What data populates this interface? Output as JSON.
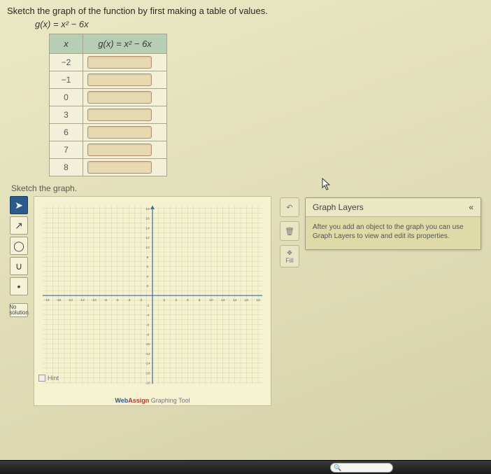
{
  "instruction": "Sketch the graph of the function by first making a table of values.",
  "equation_lhs": "g(x)",
  "equation_rhs": "x² − 6x",
  "table": {
    "col_x": "x",
    "col_g_lhs": "g(x)",
    "col_g_rhs": "x² − 6x",
    "x_values": [
      "−2",
      "−1",
      "0",
      "3",
      "6",
      "7",
      "8"
    ]
  },
  "sketch_label": "Sketch the graph.",
  "toolbar": {
    "select": "➤",
    "line": "↗",
    "circle": "◯",
    "parabola": "∪",
    "point": "•",
    "noSolution": "No\nsolution"
  },
  "side": {
    "undo": "↶",
    "trash": "🗑",
    "fill_icon": "✥",
    "fill_label": "Fill"
  },
  "layers": {
    "title": "Graph Layers",
    "collapse": "«",
    "body": "After you add an object to the graph you can use Graph Layers to view and edit its properties."
  },
  "brand_prefix": "Web",
  "brand_mid": "Assign",
  "brand_suffix": " Graphing Tool",
  "hint_label": "Hint",
  "search_icon": "🔍",
  "chart_data": {
    "type": "line",
    "title": "",
    "xlabel": "",
    "ylabel": "",
    "xlim": [
      -18,
      18
    ],
    "ylim": [
      -18,
      18
    ],
    "x_ticks": [
      -18,
      -16,
      -14,
      -12,
      -10,
      -8,
      -6,
      -4,
      -2,
      2,
      4,
      6,
      8,
      10,
      12,
      14,
      16,
      18
    ],
    "y_ticks": [
      -18,
      -16,
      -14,
      -12,
      -10,
      -8,
      -6,
      -4,
      -2,
      2,
      4,
      6,
      8,
      10,
      12,
      14,
      16,
      18
    ],
    "series": []
  }
}
